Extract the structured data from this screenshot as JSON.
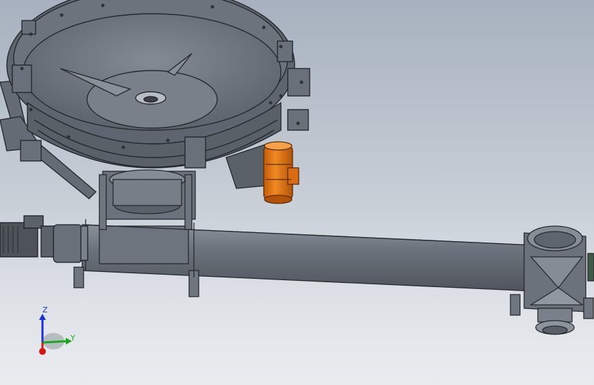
{
  "viewport": {
    "background_top": "#a7b1bf",
    "background_bottom": "#e9ecef",
    "model_color": "#6a7079",
    "highlight_color": "#e07a1a"
  },
  "triad": {
    "z_label": "Z",
    "y_label": "Y",
    "z_color": "#1a2fd6",
    "y_color": "#18a81a",
    "x_color": "#d01818"
  }
}
